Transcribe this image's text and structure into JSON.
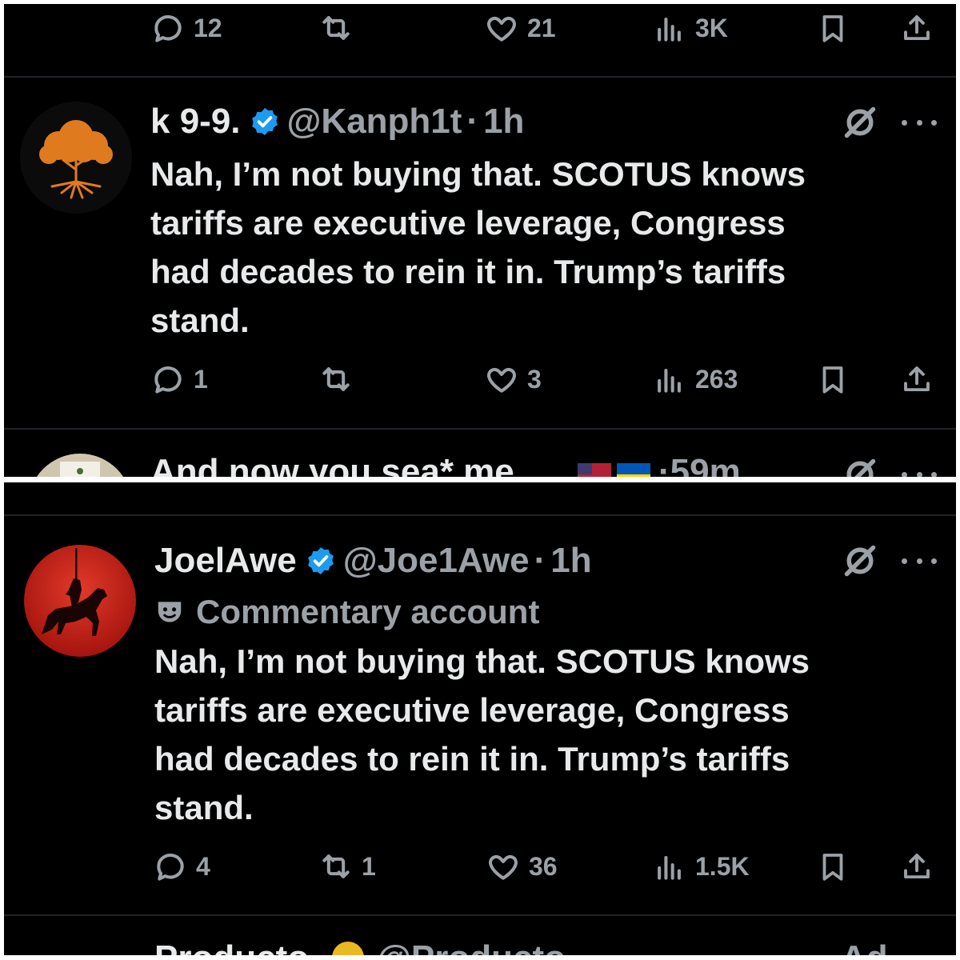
{
  "panel_top": {
    "prev_actions": {
      "replies": "12",
      "reposts": "",
      "likes": "21",
      "views": "3K"
    },
    "tweet": {
      "name": "k 9-9.",
      "handle": "@Kanph1t",
      "time": "1h",
      "text": "Nah, I’m not buying that. SCOTUS knows\ntariffs are executive leverage, Congress\nhad decades to rein it in. Trump’s tariffs\nstand.",
      "actions": {
        "replies": "1",
        "reposts": "",
        "likes": "3",
        "views": "263"
      }
    },
    "next_tweet": {
      "name_partial": "And now you sea* me",
      "time": "59m"
    }
  },
  "panel_bottom": {
    "tweet": {
      "name": "JoelAwe",
      "handle": "@Joe1Awe",
      "time": "1h",
      "label": "Commentary account",
      "text": "Nah, I’m not buying that. SCOTUS knows\ntariffs are executive leverage, Congress\nhad decades to rein it in. Trump’s tariffs\nstand.",
      "actions": {
        "replies": "4",
        "reposts": "1",
        "likes": "36",
        "views": "1.5K"
      }
    },
    "next_tweet": {
      "name_partial": "Producto",
      "handle_partial": "@Producto",
      "ad_partial": "Ad"
    }
  },
  "icons": {
    "reply": "reply-icon",
    "repost": "repost-icon",
    "like": "heart-icon",
    "views": "views-icon",
    "bookmark": "bookmark-icon",
    "share": "share-icon",
    "verified": "verified-badge-icon",
    "grok": "grok-icon",
    "more": "more-icon",
    "commentary": "theater-mask-icon"
  },
  "colors": {
    "background": "#000000",
    "text": "#e7e9ea",
    "muted": "#9ba1a6",
    "verified": "#1d9bf0",
    "gold": "#e8b923"
  }
}
